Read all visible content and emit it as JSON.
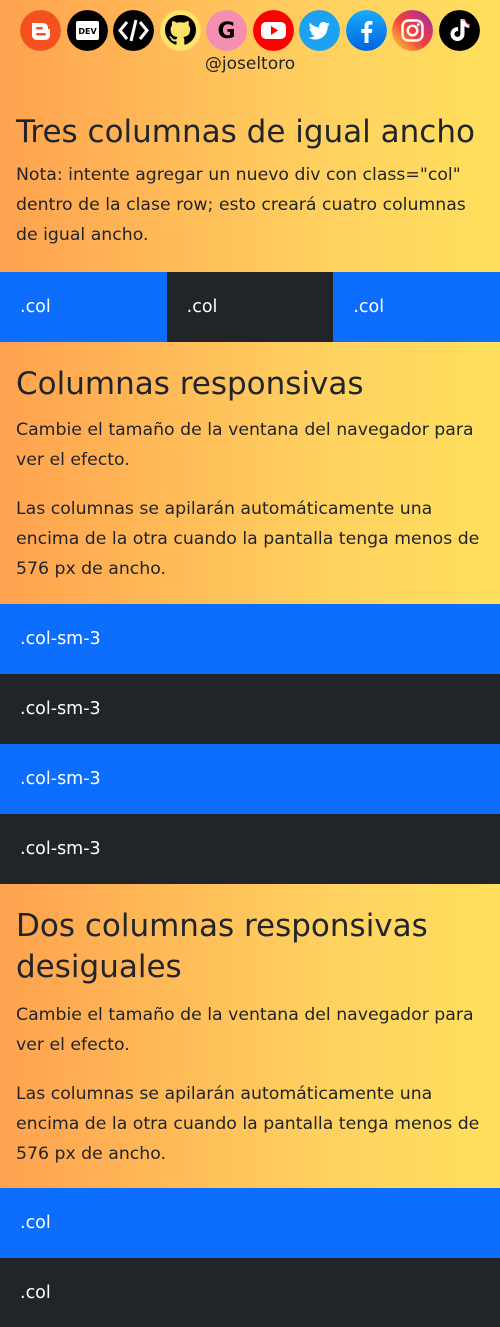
{
  "social": {
    "icons": [
      {
        "name": "blogger-icon",
        "color": "#f4511e"
      },
      {
        "name": "dev-icon",
        "color": "#000000"
      },
      {
        "name": "code-icon",
        "color": "#000000"
      },
      {
        "name": "github-icon",
        "color": "#000000"
      },
      {
        "name": "google-icon",
        "color": "#f48fb1"
      },
      {
        "name": "youtube-icon",
        "color": "#ff0000"
      },
      {
        "name": "twitter-icon",
        "color": "#1da1f2"
      },
      {
        "name": "facebook-icon",
        "color": "#1877f2"
      },
      {
        "name": "instagram-icon",
        "color": "#c13584"
      },
      {
        "name": "tiktok-icon",
        "color": "#000000"
      }
    ],
    "handle": "@joseltoro"
  },
  "section1": {
    "title": "Tres columnas de igual ancho",
    "note": "Nota: intente agregar un nuevo div con class=\"col\" dentro de la clase row; esto creará cuatro columnas de igual ancho.",
    "columns": [
      ".col",
      ".col",
      ".col"
    ]
  },
  "section2": {
    "title": "Columnas responsivas",
    "p1": "Cambie el tamaño de la ventana del navegador para ver el efecto.",
    "p2": "Las columnas se apilarán automáticamente una encima de la otra cuando la pantalla tenga menos de 576 px de ancho.",
    "columns": [
      ".col-sm-3",
      ".col-sm-3",
      ".col-sm-3",
      ".col-sm-3"
    ]
  },
  "section3": {
    "title": "Dos columnas responsivas desiguales",
    "p1": "Cambie el tamaño de la ventana del navegador para ver el efecto.",
    "p2": "Las columnas se apilarán automáticamente una encima de la otra cuando la pantalla tenga menos de 576 px de ancho.",
    "columns": [
      ".col",
      ".col"
    ]
  },
  "colors": {
    "blue": "#0d6efd",
    "dark": "#212529",
    "gradient_start": "#ffa24f",
    "gradient_end": "#ffe05e"
  }
}
